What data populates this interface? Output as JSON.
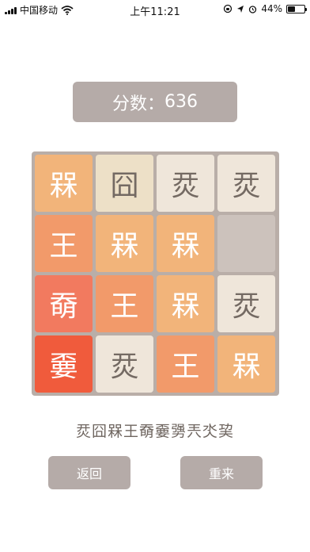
{
  "status_bar": {
    "carrier": "中国移动",
    "time": "上午11:21",
    "battery": "44%",
    "battery_level": 0.44,
    "icons": [
      "signal-icon",
      "wifi-icon",
      "orientation-lock-icon",
      "location-icon",
      "alarm-icon",
      "battery-icon"
    ]
  },
  "score": {
    "label": "分数：",
    "value": "636"
  },
  "board": {
    "rows": [
      [
        {
          "char": "槑",
          "level": 3
        },
        {
          "char": "囧",
          "level": 2
        },
        {
          "char": "烎",
          "level": 1
        },
        {
          "char": "烎",
          "level": 1
        }
      ],
      [
        {
          "char": "王",
          "level": 4
        },
        {
          "char": "槑",
          "level": 3
        },
        {
          "char": "槑",
          "level": 3
        },
        {
          "char": "",
          "level": 0
        }
      ],
      [
        {
          "char": "奣",
          "level": 5
        },
        {
          "char": "王",
          "level": 4
        },
        {
          "char": "槑",
          "level": 3
        },
        {
          "char": "烎",
          "level": 1
        }
      ],
      [
        {
          "char": "嫑",
          "level": 6
        },
        {
          "char": "烎",
          "level": 1
        },
        {
          "char": "王",
          "level": 4
        },
        {
          "char": "槑",
          "level": 3
        }
      ]
    ]
  },
  "sequence": "烎囧槑王奣嫑勥兲氼巭",
  "buttons": {
    "back": "返回",
    "restart": "重来"
  },
  "colors": {
    "panel": "#b5aba8",
    "board": "#b9aea8",
    "empty_tile": "#ccc2bc",
    "level_1": "#efe6da",
    "level_2": "#ede0c7",
    "level_3": "#f2b47a",
    "level_4": "#f29a6a",
    "level_5": "#f27a5f",
    "level_6": "#f05b3c"
  }
}
